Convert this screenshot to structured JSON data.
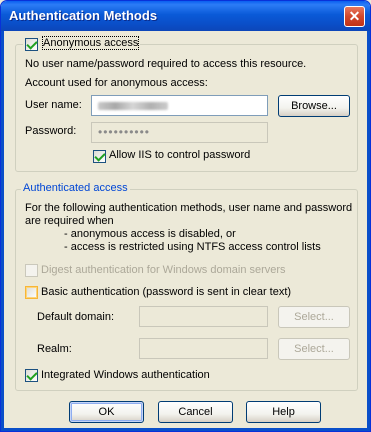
{
  "window": {
    "title": "Authentication Methods"
  },
  "anonymous": {
    "checkbox_label": "Anonymous access",
    "checked": true,
    "description": "No user name/password required to access this resource.",
    "account_heading": "Account used for anonymous access:",
    "username_label": "User name:",
    "browse_button": "Browse...",
    "password_label": "Password:",
    "password_mask": "••••••••••",
    "allow_iis_label": "Allow IIS to control password",
    "allow_iis_checked": true
  },
  "authenticated": {
    "group_title": "Authenticated access",
    "desc_line1": "For the following authentication methods, user name and password",
    "desc_line2": "are required when",
    "desc_bullet1": "- anonymous access is disabled, or",
    "desc_bullet2": "- access is restricted using NTFS access control lists",
    "digest_label": "Digest authentication for Windows domain servers",
    "digest_checked": false,
    "basic_label": "Basic authentication (password is sent in clear text)",
    "basic_checked": false,
    "default_domain_label": "Default domain:",
    "select_button": "Select...",
    "realm_label": "Realm:",
    "integrated_label": "Integrated Windows authentication",
    "integrated_checked": true
  },
  "buttons": {
    "ok": "OK",
    "cancel": "Cancel",
    "help": "Help"
  },
  "icons": {
    "close": "close-icon"
  },
  "colors": {
    "titlebar": "#0a5ad8",
    "group_title": "#0046d5",
    "dialog_bg": "#ece9d8"
  }
}
